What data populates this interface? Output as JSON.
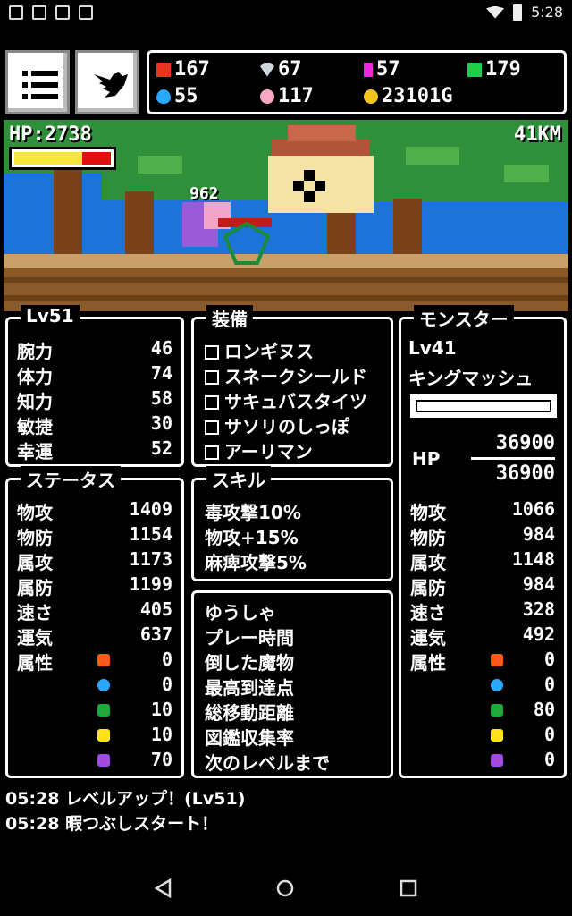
{
  "status": {
    "time": "5:28"
  },
  "resources": {
    "red": "167",
    "silver": "67",
    "magenta": "57",
    "green": "179",
    "blue": "55",
    "pink": "117",
    "gold": "23101G"
  },
  "battle": {
    "hp_label": "HP:2738",
    "hp_fraction": 0.7,
    "distance": "41KM",
    "damage": "962"
  },
  "player_stats": {
    "level": "Lv51",
    "rows": [
      {
        "k": "腕力",
        "v": "46"
      },
      {
        "k": "体力",
        "v": "74"
      },
      {
        "k": "知力",
        "v": "58"
      },
      {
        "k": "敏捷",
        "v": "30"
      },
      {
        "k": "幸運",
        "v": "52"
      }
    ]
  },
  "equipment": {
    "title": "装備",
    "items": [
      "ロンギヌス",
      "スネークシールド",
      "サキュバスタイツ",
      "サソリのしっぽ",
      "アーリマン"
    ]
  },
  "monster": {
    "title": "モンスター",
    "level": "Lv41",
    "name": "キングマッシュ",
    "hp_label": "HP",
    "hp_current": "36900",
    "hp_max": "36900",
    "rows": [
      {
        "k": "物攻",
        "v": "1066"
      },
      {
        "k": "物防",
        "v": "984"
      },
      {
        "k": "属攻",
        "v": "1148"
      },
      {
        "k": "属防",
        "v": "984"
      },
      {
        "k": "速さ",
        "v": "328"
      },
      {
        "k": "運気",
        "v": "492"
      }
    ],
    "attr_label": "属性",
    "attrs": [
      "0",
      "0",
      "80",
      "0",
      "0"
    ]
  },
  "status_panel": {
    "title": "ステータス",
    "rows": [
      {
        "k": "物攻",
        "v": "1409"
      },
      {
        "k": "物防",
        "v": "1154"
      },
      {
        "k": "属攻",
        "v": "1173"
      },
      {
        "k": "属防",
        "v": "1199"
      },
      {
        "k": "速さ",
        "v": "405"
      },
      {
        "k": "運気",
        "v": "637"
      }
    ],
    "attr_label": "属性",
    "attrs": [
      "0",
      "0",
      "10",
      "10",
      "70"
    ]
  },
  "skills": {
    "title": "スキル",
    "items": [
      "毒攻撃10%",
      "物攻+15%",
      "麻痺攻撃5%"
    ]
  },
  "info": {
    "items": [
      "ゆうしゃ",
      "プレー時間",
      "倒した魔物",
      "最高到達点",
      "総移動距離",
      "図鑑収集率",
      "次のレベルまで"
    ]
  },
  "log": [
    "05:28 レベルアップ！(Lv51)",
    "05:28 暇つぶしスタート！"
  ],
  "colors": {
    "fire": "#ff5a1a",
    "water": "#2aa7ff",
    "wind": "#1faa3a",
    "holy": "#ffe21a",
    "dark": "#a04adf"
  }
}
